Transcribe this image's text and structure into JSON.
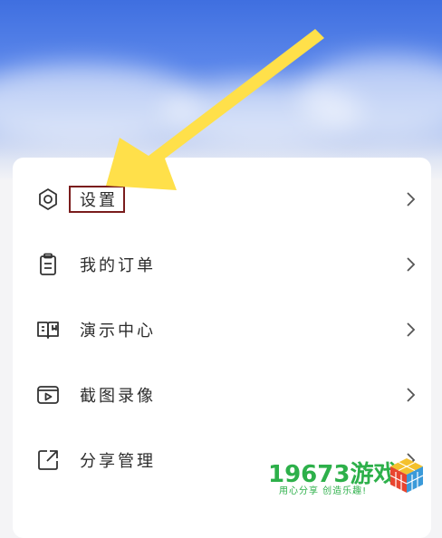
{
  "menu": {
    "items": [
      {
        "label": "设置",
        "icon": "gear-icon"
      },
      {
        "label": "我的订单",
        "icon": "clipboard-icon"
      },
      {
        "label": "演示中心",
        "icon": "book-icon"
      },
      {
        "label": "截图录像",
        "icon": "video-icon"
      },
      {
        "label": "分享管理",
        "icon": "share-icon"
      }
    ]
  },
  "watermark": {
    "brand": "19673游戏",
    "slogan": "用心分享 创造乐趣!"
  },
  "colors": {
    "accent_arrow": "#ffe04a",
    "highlight_border": "#7a1c1c",
    "watermark_green": "#2db04a"
  }
}
